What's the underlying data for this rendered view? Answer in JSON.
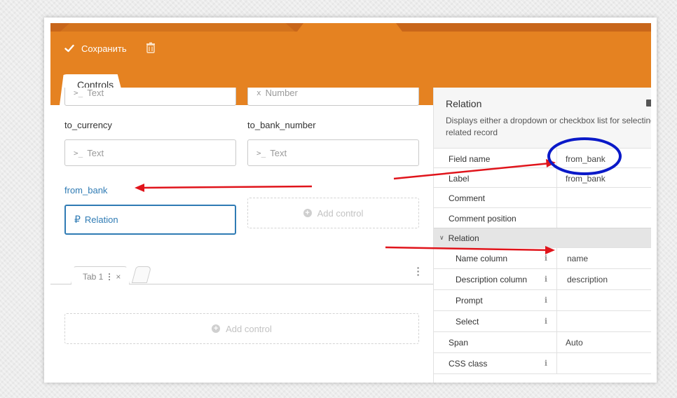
{
  "toolbar": {
    "save_label": "Сохранить"
  },
  "controls_tab": {
    "label": "Controls"
  },
  "form": {
    "partial_fields": [
      {
        "icon": ">_",
        "placeholder": "Text"
      },
      {
        "icon": "x",
        "placeholder": "Number"
      }
    ],
    "fields": [
      {
        "label": "to_currency",
        "icon": ">_",
        "placeholder": "Text"
      },
      {
        "label": "to_bank_number",
        "icon": ">_",
        "placeholder": "Text"
      },
      {
        "label": "from_bank",
        "icon": "₽",
        "placeholder": "Relation"
      }
    ],
    "add_control_label": "Add control",
    "tab": {
      "label": "Tab 1",
      "close": "×"
    }
  },
  "inspector": {
    "title": "Relation",
    "description_line1": "Displays either a dropdown or checkbox list for selecting",
    "description_line2": "related record",
    "rows_top": [
      {
        "name": "Field name",
        "value": "from_bank"
      },
      {
        "name": "Label",
        "value": "from_bank"
      },
      {
        "name": "Comment",
        "value": ""
      },
      {
        "name": "Comment position",
        "value": ""
      }
    ],
    "section": {
      "label": "Relation"
    },
    "rows_section": [
      {
        "name": "Name column",
        "value": "name"
      },
      {
        "name": "Description column",
        "value": "description"
      },
      {
        "name": "Prompt",
        "value": ""
      },
      {
        "name": "Select",
        "value": ""
      }
    ],
    "rows_bottom": [
      {
        "name": "Span",
        "value": "Auto",
        "info": false
      },
      {
        "name": "CSS class",
        "value": "",
        "info": true
      }
    ],
    "info_glyph": "i"
  },
  "colors": {
    "accent_orange": "#e58221",
    "active_blue": "#2f7bb4",
    "annotation_red": "#e0141b",
    "annotation_blue": "#0a19c8"
  }
}
